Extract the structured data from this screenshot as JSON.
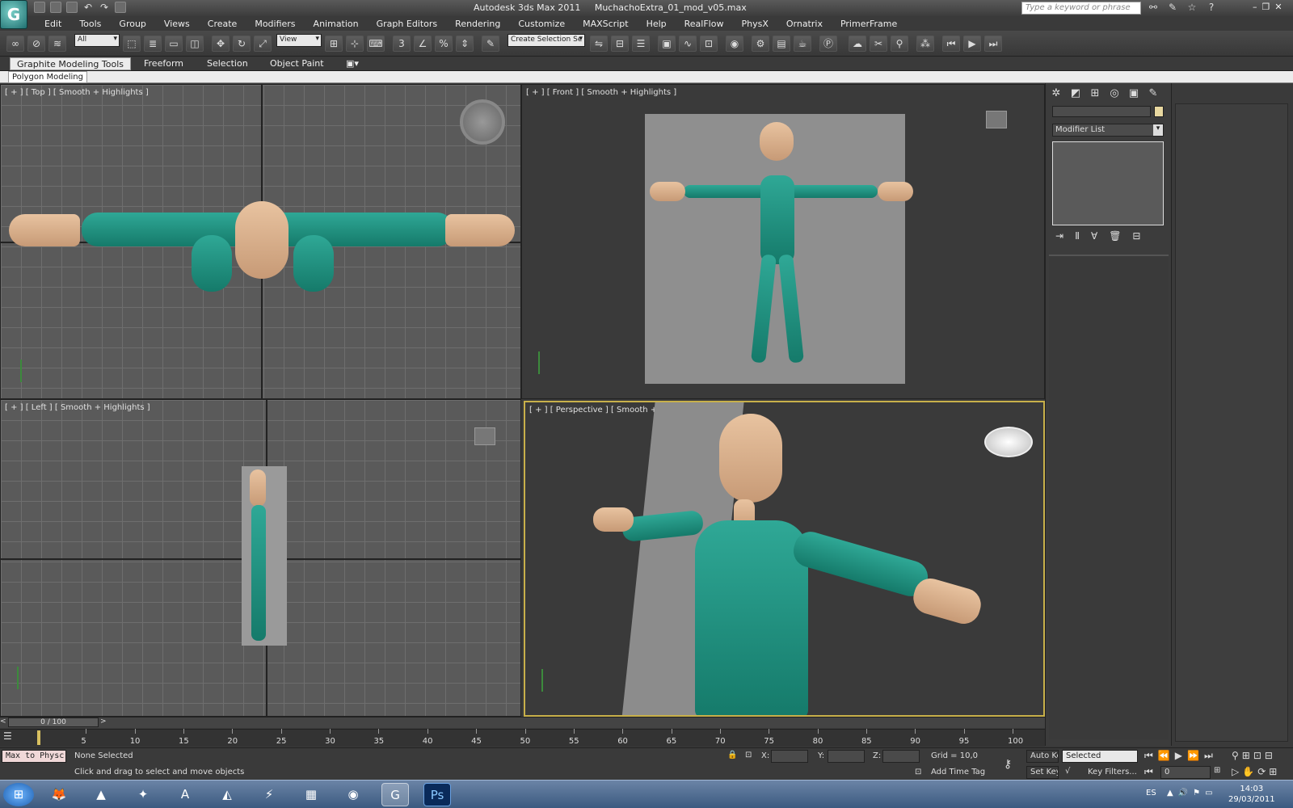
{
  "window": {
    "app_title": "Autodesk 3ds Max  2011",
    "file_title": "MuchachoExtra_01_mod_v05.max",
    "search_placeholder": "Type a keyword or phrase"
  },
  "menu": [
    "Edit",
    "Tools",
    "Group",
    "Views",
    "Create",
    "Modifiers",
    "Animation",
    "Graph Editors",
    "Rendering",
    "Customize",
    "MAXScript",
    "Help",
    "RealFlow",
    "PhysX",
    "Ornatrix",
    "PrimerFrame"
  ],
  "toolbar": {
    "selection_filter": "All",
    "reference_coord": "View",
    "named_selection": "Create Selection Se"
  },
  "ribbon": {
    "tabs": [
      "Graphite Modeling Tools",
      "Freeform",
      "Selection",
      "Object Paint"
    ],
    "active_panel": "Polygon Modeling"
  },
  "viewports": {
    "top": "[ + ] [ Top ] [ Smooth + Highlights ]",
    "front": "[ + ] [ Front ] [ Smooth + Highlights ]",
    "left": "[ + ] [ Left ] [ Smooth + Highlights ]",
    "perspective": "[ + ] [ Perspective ] [ Smooth + Highlights ]"
  },
  "command_panel": {
    "modifier_list": "Modifier List"
  },
  "timeline": {
    "slider": "0 / 100",
    "ticks": [
      "5",
      "10",
      "15",
      "20",
      "25",
      "30",
      "35",
      "40",
      "45",
      "50",
      "55",
      "60",
      "65",
      "70",
      "75",
      "80",
      "85",
      "90",
      "95",
      "100"
    ]
  },
  "status": {
    "maxscript": "Max to Physc",
    "selection": "None Selected",
    "prompt": "Click and drag to select and move objects",
    "x_label": "X:",
    "y_label": "Y:",
    "z_label": "Z:",
    "grid": "Grid = 10,0",
    "add_time_tag": "Add Time Tag",
    "auto_key": "Auto Key",
    "set_key": "Set Key",
    "key_mode": "Selected",
    "key_filters": "Key Filters...",
    "frame": "0"
  },
  "taskbar": {
    "lang": "ES",
    "time": "14:03",
    "date": "29/03/2011"
  },
  "colors": {
    "body_green": "#2fa896",
    "skin": "#e0b894",
    "active_viewport": "#c8b04a"
  }
}
